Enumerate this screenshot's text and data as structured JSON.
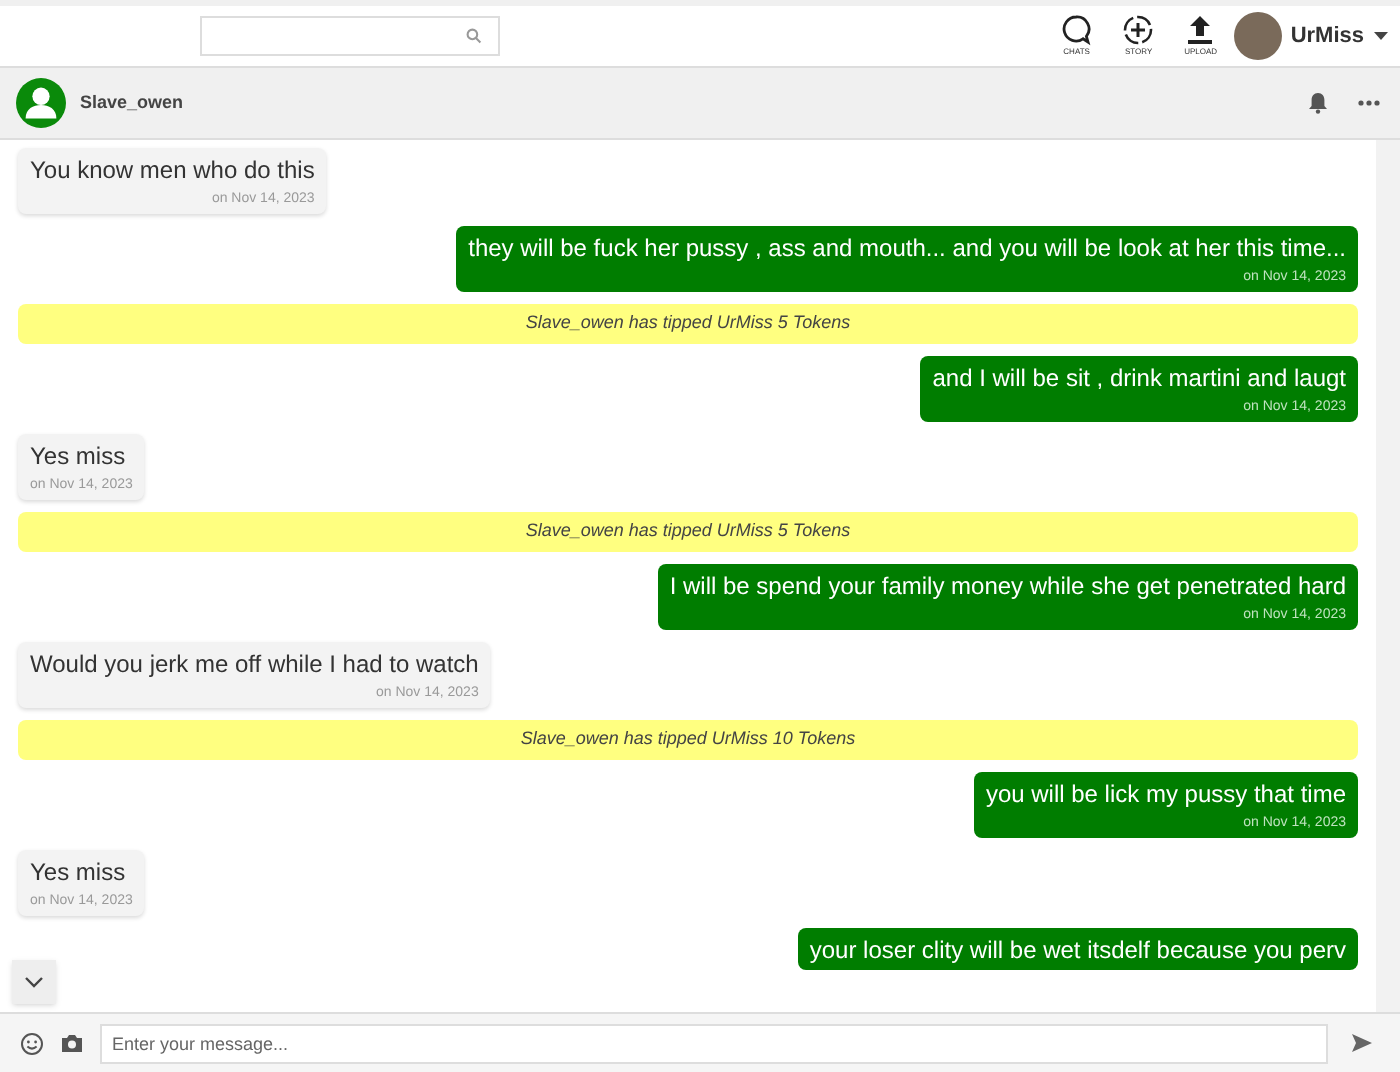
{
  "top_bar": {
    "nav": [
      {
        "kind": "chats",
        "label": "CHATS"
      },
      {
        "kind": "story",
        "label": "STORY"
      },
      {
        "kind": "upload",
        "label": "UPLOAD"
      }
    ],
    "user": {
      "name": "UrMiss"
    }
  },
  "chat_header": {
    "name": "Slave_owen"
  },
  "messages": [
    {
      "kind": "received",
      "text": "You know men who do this",
      "time": "on Nov 14, 2023"
    },
    {
      "kind": "sent",
      "text": "they will be fuck her pussy , ass and mouth... and you will be look at her this time...",
      "time": "on Nov 14, 2023"
    },
    {
      "kind": "tip",
      "text": "Slave_owen has tipped UrMiss 5 Tokens"
    },
    {
      "kind": "sent",
      "text": "and I will be sit , drink martini and laugt",
      "time": "on Nov 14, 2023"
    },
    {
      "kind": "received",
      "text": "Yes miss",
      "time": "on Nov 14, 2023"
    },
    {
      "kind": "tip",
      "text": "Slave_owen has tipped UrMiss 5 Tokens"
    },
    {
      "kind": "sent",
      "text": "I will be spend your family money while she get penetrated hard",
      "time": "on Nov 14, 2023"
    },
    {
      "kind": "received",
      "text": "Would you jerk me off while I had to watch",
      "time": "on Nov 14, 2023"
    },
    {
      "kind": "tip",
      "text": "Slave_owen has tipped UrMiss 10 Tokens"
    },
    {
      "kind": "sent",
      "text": "you will be lick my pussy that time",
      "time": "on Nov 14, 2023"
    },
    {
      "kind": "received",
      "text": "Yes miss",
      "time": "on Nov 14, 2023"
    },
    {
      "kind": "sent",
      "text": "your loser clity will be wet itsdelf because you perv"
    }
  ],
  "composer": {
    "placeholder": "Enter your message..."
  }
}
